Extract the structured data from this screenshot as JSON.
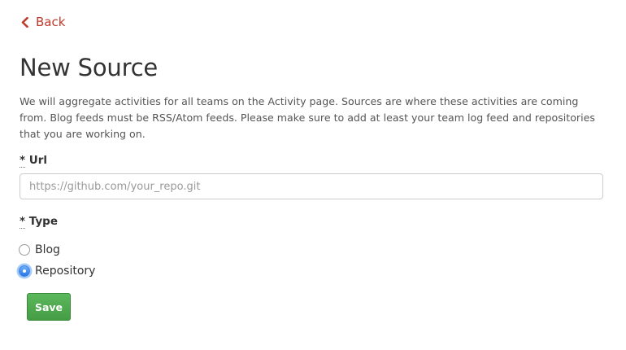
{
  "nav": {
    "back_label": "Back",
    "back_icon": "chevron-left-icon"
  },
  "page": {
    "title": "New Source",
    "description": "We will aggregate activities for all teams on the Activity page. Sources are where these activities are coming from. Blog feeds must be RSS/Atom feeds. Please make sure to add at least your team log feed and repositories that you are working on."
  },
  "form": {
    "url": {
      "required_marker": "*",
      "label": "Url",
      "placeholder": "https://github.com/your_repo.git",
      "value": ""
    },
    "type": {
      "required_marker": "*",
      "label": "Type",
      "options": [
        {
          "label": "Blog",
          "selected": false
        },
        {
          "label": "Repository",
          "selected": true
        }
      ]
    },
    "save_label": "Save"
  },
  "colors": {
    "link": "#c0392b",
    "save_button": "#4cae4c",
    "radio_selected": "#3b84e8"
  }
}
